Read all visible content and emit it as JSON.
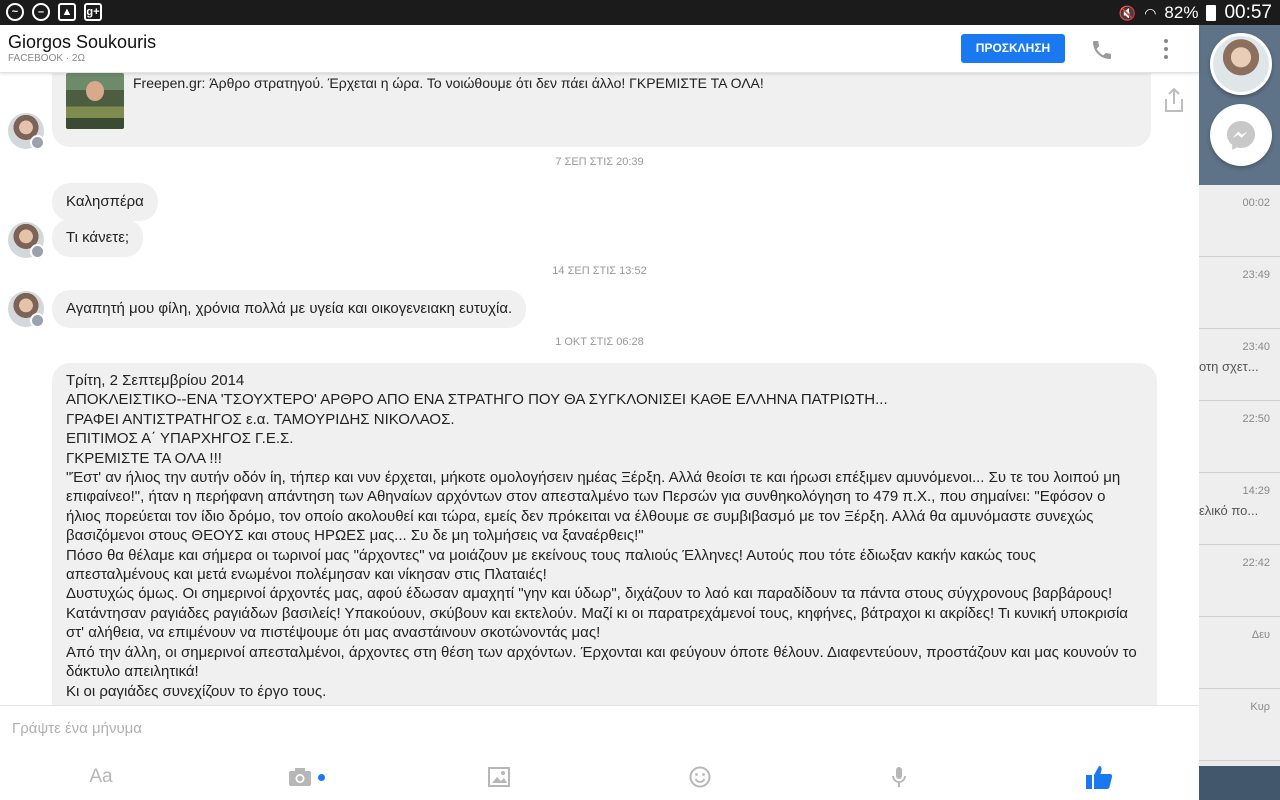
{
  "statusbar": {
    "battery": "82%",
    "time": "00:57"
  },
  "header": {
    "name": "Giorgos Soukouris",
    "source": "FACEBOOK · 2Ω",
    "invite_label": "ΠΡΟΣΚΛΗΣΗ"
  },
  "messages": {
    "link_preview": "Freepen.gr: Άρθρο στρατηγού. Έρχεται η ώρα. Το νοιώθουμε ότι δεν πάει άλλο! ΓΚΡΕΜΙΣΤΕ ΤΑ ΟΛΑ!",
    "stamp1": "7 ΣΕΠ ΣΤΙΣ 20:39",
    "msg1": "Καλησπέρα",
    "msg2": "Τι κάνετε;",
    "stamp2": "14 ΣΕΠ ΣΤΙΣ 13:52",
    "msg3": "Αγαπητή μου φίλη, χρόνια πολλά με υγεία και οικογενειακη ευτυχία.",
    "stamp3": "1 ΟΚΤ ΣΤΙΣ 06:28",
    "long": [
      "Τρίτη, 2 Σεπτεμβρίου 2014",
      "ΑΠΟΚΛΕΙΣΤΙΚΟ--ΕΝΑ 'ΤΣΟΥΧΤΕΡΟ' ΑΡΘΡΟ ΑΠΟ ΕΝΑ ΣΤΡΑΤΗΓΟ ΠΟΥ ΘΑ ΣΥΓΚΛΟΝΙΣΕΙ ΚΑΘΕ ΕΛΛΗΝΑ ΠΑΤΡΙΩΤΗ...",
      "ΓΡΑΦΕΙ ΑΝΤΙΣΤΡΑΤΗΓΟΣ ε.α. ΤΑΜΟΥΡΙΔΗΣ ΝΙΚΟΛΑΟΣ.",
      "ΕΠΙΤΙΜΟΣ Α΄ ΥΠΑΡΧΗΓΟΣ Γ.Ε.Σ.",
      "ΓΚΡΕΜΙΣΤΕ ΤΑ ΟΛΑ !!!",
      "\"Έστ' αν ήλιος την αυτήν οδόν ίη, τήπερ και νυν έρχεται, μήκοτε ομολογήσειν ημέας Ξέρξη. Αλλά θεοίσι τε και ήρωσι επέξιμεν αμυνόμενοι... Συ τε του λοιπού μη επιφαίνεο!\", ήταν η περήφανη απάντηση των Αθηναίων αρχόντων στον απεσταλμένο των Περσών για συνθηκολόγηση το 479 π.Χ., που σημαίνει: \"Εφόσον ο ήλιος πορεύεται τον ίδιο δρόμο, τον οποίο ακολουθεί και τώρα, εμείς δεν πρόκειται να έλθουμε σε συμβιβασμό με τον Ξέρξη. Αλλά θα αμυνόμαστε συνεχώς βασιζόμενοι στους ΘΕΟΥΣ και στους ΗΡΩΕΣ μας... Συ δε μη τολμήσεις να ξαναέρθεις!\"",
      "Πόσο θα θέλαμε και σήμερα οι τωρινοί μας \"άρχοντες\" να μοιάζουν με εκείνους τους παλιούς Έλληνες! Αυτούς που τότε έδιωξαν κακήν κακώς τους απεσταλμένους και μετά ενωμένοι πολέμησαν και νίκησαν στις Πλαταιές!",
      "Δυστυχώς όμως. Οι σημερινοί άρχοντές μας, αφού έδωσαν αμαχητί \"γην και ύδωρ\", διχάζουν το λαό και παραδίδουν τα πάντα στους σύγχρονους βαρβάρους! Κατάντησαν ραγιάδες ραγιάδων βασιλείς! Υπακούουν, σκύβουν και εκτελούν. Μαζί κι οι παρατρεχάμενοί τους, κηφήνες, βάτραχοι κι ακρίδες! Τι κυνική υποκρισία στ' αλήθεια, να επιμένουν να πιστέψουμε ότι μας αναστάινουν σκοτώνοντάς μας!",
      "Από την άλλη, οι σημερινοί απεσταλμένοι, άρχοντες στη θέση των αρχόντων. Έρχονται και φεύγουν όποτε θέλουν. Διαφεντεύουν, προστάζουν και μας κουνούν το δάκτυλο απειλητικά!",
      "Κι οι ραγιάδες συνεχίζουν το έργο τους."
    ]
  },
  "compose": {
    "placeholder": "Γράψτε ένα μήνυμα",
    "text_tool": "Aa"
  },
  "background_list": {
    "times": [
      "00:02",
      "23:49",
      "23:40",
      "22:50",
      "14:29",
      "22:42",
      "Δευ",
      "Κυρ"
    ],
    "snippets": [
      "",
      "",
      "οτη σχετ...",
      "",
      "ελικό πο...",
      "",
      "",
      ""
    ]
  },
  "colors": {
    "accent": "#1a78f0",
    "bubble": "#f0f0f0",
    "statusbar": "#1b1b1b"
  }
}
